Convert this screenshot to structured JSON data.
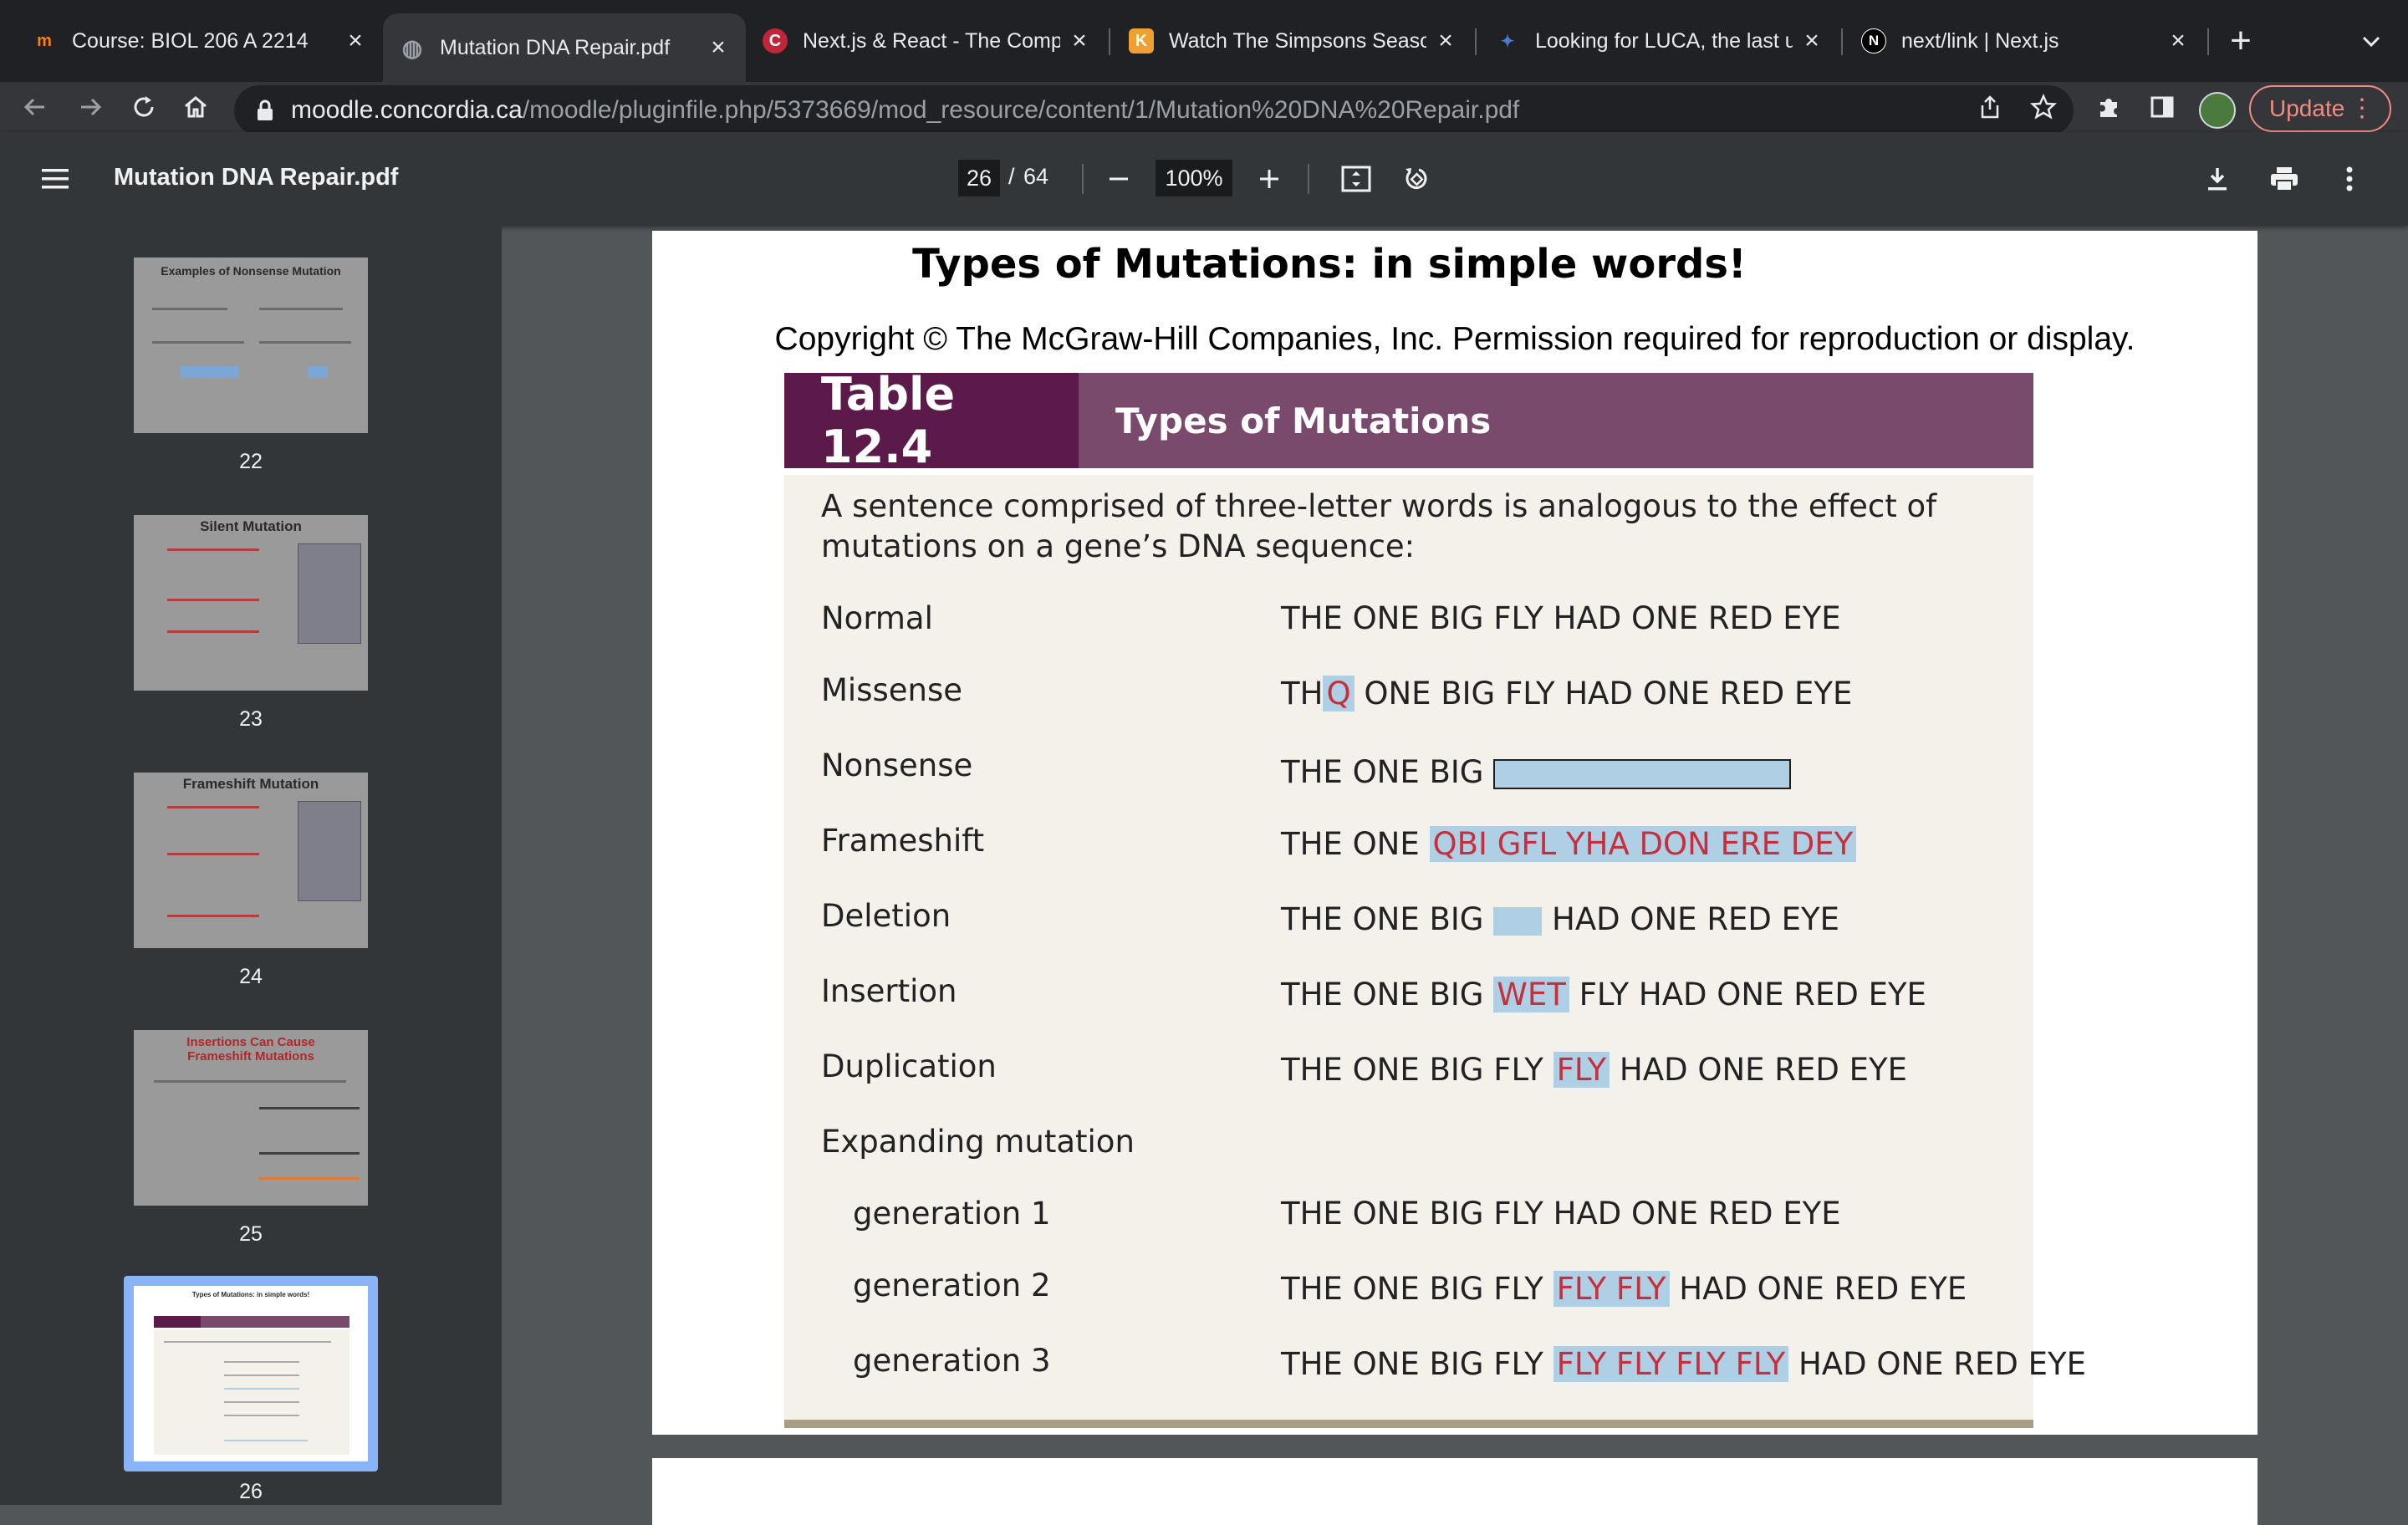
{
  "browser": {
    "tabs": [
      {
        "title": "Course: BIOL 206 A 2214",
        "favicon": "moodle-icon",
        "favicon_text": "m",
        "favicon_color": "#f98012",
        "active": false
      },
      {
        "title": "Mutation DNA Repair.pdf",
        "favicon": "globe-icon",
        "favicon_text": "◍",
        "favicon_color": "#9aa0a6",
        "active": true
      },
      {
        "title": "Next.js & React - The Comp",
        "favicon": "course-icon",
        "favicon_text": "C",
        "favicon_color": "#c0263a",
        "active": false
      },
      {
        "title": "Watch The Simpsons Seaso",
        "favicon": "kiss-icon",
        "favicon_text": "K",
        "favicon_color": "#f0a030",
        "active": false
      },
      {
        "title": "Looking for LUCA, the last u",
        "favicon": "science-icon",
        "favicon_text": "✦",
        "favicon_color": "#4a7bd0",
        "active": false
      },
      {
        "title": "next/link | Next.js",
        "favicon": "nextjs-icon",
        "favicon_text": "N",
        "favicon_color": "#000000",
        "active": false
      }
    ],
    "url_host": "moodle.concordia.ca",
    "url_path": "/moodle/pluginfile.php/5373669/mod_resource/content/1/Mutation%20DNA%20Repair.pdf",
    "update_label": "Update"
  },
  "pdf_viewer": {
    "file_name": "Mutation DNA Repair.pdf",
    "current_page": "26",
    "page_separator": "/",
    "total_pages": "64",
    "zoom": "100%"
  },
  "thumbnails": [
    {
      "page": "22",
      "title": "Examples of Nonsense Mutation"
    },
    {
      "page": "23",
      "title": "Silent Mutation"
    },
    {
      "page": "24",
      "title": "Frameshift Mutation"
    },
    {
      "page": "25",
      "title": "Insertions Can Cause Frameshift Mutations"
    },
    {
      "page": "26",
      "title": "Types of Mutations: in simple words!"
    }
  ],
  "document": {
    "title": "Types of Mutations: in simple words!",
    "copyright": "Copyright © The McGraw-Hill Companies, Inc. Permission required for reproduction or display.",
    "table_number": "Table 12.4",
    "table_title": "Types of Mutations",
    "intro": "A sentence comprised of three-letter words is analogous to the effect of mutations on a gene’s DNA sequence:",
    "rows": {
      "normal": {
        "label": "Normal",
        "seq": "THE ONE BIG FLY HAD ONE RED EYE"
      },
      "missense": {
        "label": "Missense",
        "pre": "TH",
        "hl": "Q",
        "post": " ONE BIG FLY HAD ONE RED EYE"
      },
      "nonsense": {
        "label": "Nonsense",
        "pre": "THE ONE BIG "
      },
      "frameshift": {
        "label": "Frameshift",
        "pre": "THE ONE ",
        "hl": "QBI GFL YHA DON ERE DEY"
      },
      "deletion": {
        "label": "Deletion",
        "pre": "THE ONE BIG ",
        "post": " HAD ONE RED EYE"
      },
      "insertion": {
        "label": "Insertion",
        "pre": "THE ONE BIG ",
        "hl": "WET",
        "post": " FLY HAD ONE RED EYE"
      },
      "duplication": {
        "label": "Duplication",
        "pre": "THE ONE BIG FLY ",
        "hl": "FLY",
        "post": " HAD ONE RED EYE"
      },
      "expanding": {
        "label": "Expanding mutation"
      },
      "gen1": {
        "label": "generation 1",
        "seq": "THE ONE BIG FLY HAD ONE RED EYE"
      },
      "gen2": {
        "label": "generation 2",
        "pre": "THE ONE BIG FLY ",
        "hl": "FLY FLY",
        "post": " HAD ONE RED EYE"
      },
      "gen3": {
        "label": "generation 3",
        "pre": "THE ONE BIG FLY ",
        "hl": "FLY FLY FLY FLY",
        "post": " HAD ONE RED EYE"
      }
    }
  },
  "colors": {
    "table_number_bg": "#5b1a4a",
    "table_title_bg": "#7a4a6c",
    "highlight_bg": "#aecfe4",
    "highlight_text": "#c6303e",
    "table_body_bg": "#f4f1ea"
  }
}
